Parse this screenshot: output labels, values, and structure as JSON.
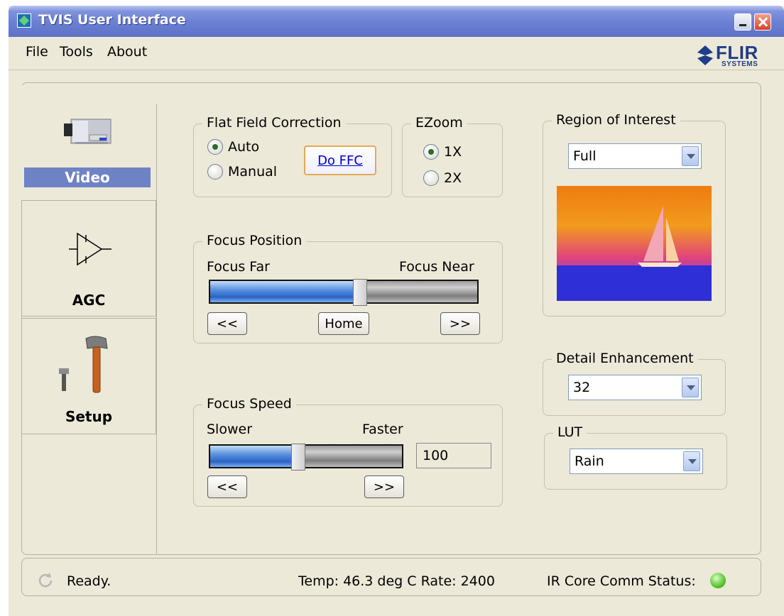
{
  "window": {
    "title": "TVIS User Interface"
  },
  "menu": {
    "file": "File",
    "tools": "Tools",
    "about": "About"
  },
  "logo": {
    "name": "FLIR",
    "sub": "SYSTEMS",
    "icon": "flir-diamond-icon"
  },
  "tabs": [
    {
      "label": "Video",
      "icon": "video-camera-icon",
      "selected": true
    },
    {
      "label": "AGC",
      "icon": "amplifier-icon",
      "selected": false
    },
    {
      "label": "Setup",
      "icon": "hammer-tools-icon",
      "selected": false
    }
  ],
  "ffc": {
    "title": "Flat Field Correction",
    "auto": "Auto",
    "manual": "Manual",
    "selected": "Auto",
    "button": "Do FFC"
  },
  "ezoom": {
    "title": "EZoom",
    "opt1": "1X",
    "opt2": "2X",
    "selected": "1X"
  },
  "focus_position": {
    "title": "Focus Position",
    "far_label": "Focus Far",
    "near_label": "Focus Near",
    "value_fraction": 0.56,
    "back_button": "<<",
    "home_button": "Home",
    "forward_button": ">>"
  },
  "focus_speed": {
    "title": "Focus Speed",
    "slower_label": "Slower",
    "faster_label": "Faster",
    "value_fraction": 0.46,
    "value_text": "100",
    "back_button": "<<",
    "forward_button": ">>"
  },
  "roi": {
    "title": "Region of Interest",
    "selected": "Full"
  },
  "detail": {
    "title": "Detail Enhancement",
    "selected": "32"
  },
  "lut": {
    "title": "LUT",
    "selected": "Rain"
  },
  "status": {
    "ready": "Ready.",
    "temp_rate": "Temp: 46.3 deg C  Rate: 2400",
    "comm": "IR Core Comm Status:",
    "comm_color": "#58c42c"
  },
  "colors": {
    "title_bar": "#6b7fd3",
    "selected_tab": "#6e82c6",
    "window_bg": "#ece9d8"
  }
}
